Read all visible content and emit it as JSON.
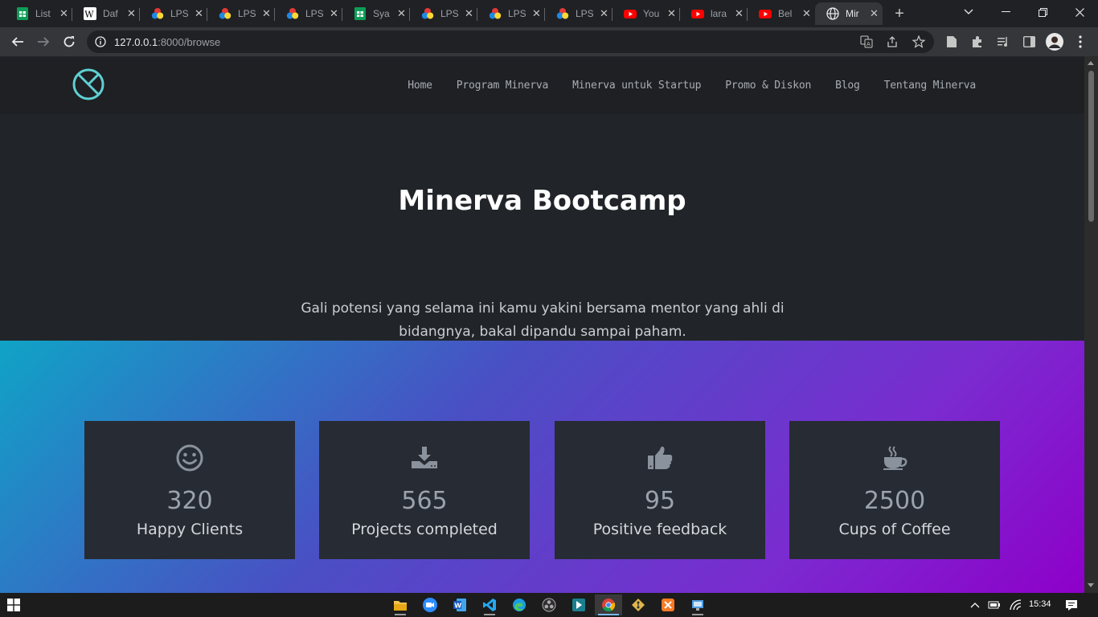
{
  "browser": {
    "tabs": [
      {
        "title": "List",
        "icon": "sheets-icon"
      },
      {
        "title": "Daf",
        "icon": "wikipedia-icon"
      },
      {
        "title": "LPS",
        "icon": "lps-icon"
      },
      {
        "title": "LPS",
        "icon": "lps-icon"
      },
      {
        "title": "LPS",
        "icon": "lps-icon"
      },
      {
        "title": "Sya",
        "icon": "sheets-icon"
      },
      {
        "title": "LPS",
        "icon": "lps-icon"
      },
      {
        "title": "LPS",
        "icon": "lps-icon"
      },
      {
        "title": "LPS",
        "icon": "lps-icon"
      },
      {
        "title": "You",
        "icon": "youtube-icon"
      },
      {
        "title": "lara",
        "icon": "youtube-icon"
      },
      {
        "title": "Bel",
        "icon": "youtube-icon"
      },
      {
        "title": "Mir",
        "icon": "globe-icon",
        "active": true
      }
    ],
    "url_host": "127.0.0.1",
    "url_rest": ":8000/browse"
  },
  "nav": {
    "links": [
      "Home",
      "Program Minerva",
      "Minerva untuk Startup",
      "Promo & Diskon",
      "Blog",
      "Tentang Minerva"
    ]
  },
  "hero": {
    "title": "Minerva Bootcamp",
    "subtitle": "Gali potensi yang selama ini kamu yakini bersama mentor yang ahli di bidangnya, bakal dipandu sampai paham."
  },
  "stats": [
    {
      "value": "320",
      "label": "Happy Clients",
      "icon": "smile-icon"
    },
    {
      "value": "565",
      "label": "Projects completed",
      "icon": "download-icon"
    },
    {
      "value": "95",
      "label": "Positive feedback",
      "icon": "thumbs-up-icon"
    },
    {
      "value": "2500",
      "label": "Cups of Coffee",
      "icon": "coffee-icon"
    }
  ],
  "taskbar": {
    "clock": "15:34"
  },
  "colors": {
    "accent_logo": "#5fd0d2",
    "gradient_start": "#10a3c6",
    "gradient_end": "#8e00c9"
  }
}
